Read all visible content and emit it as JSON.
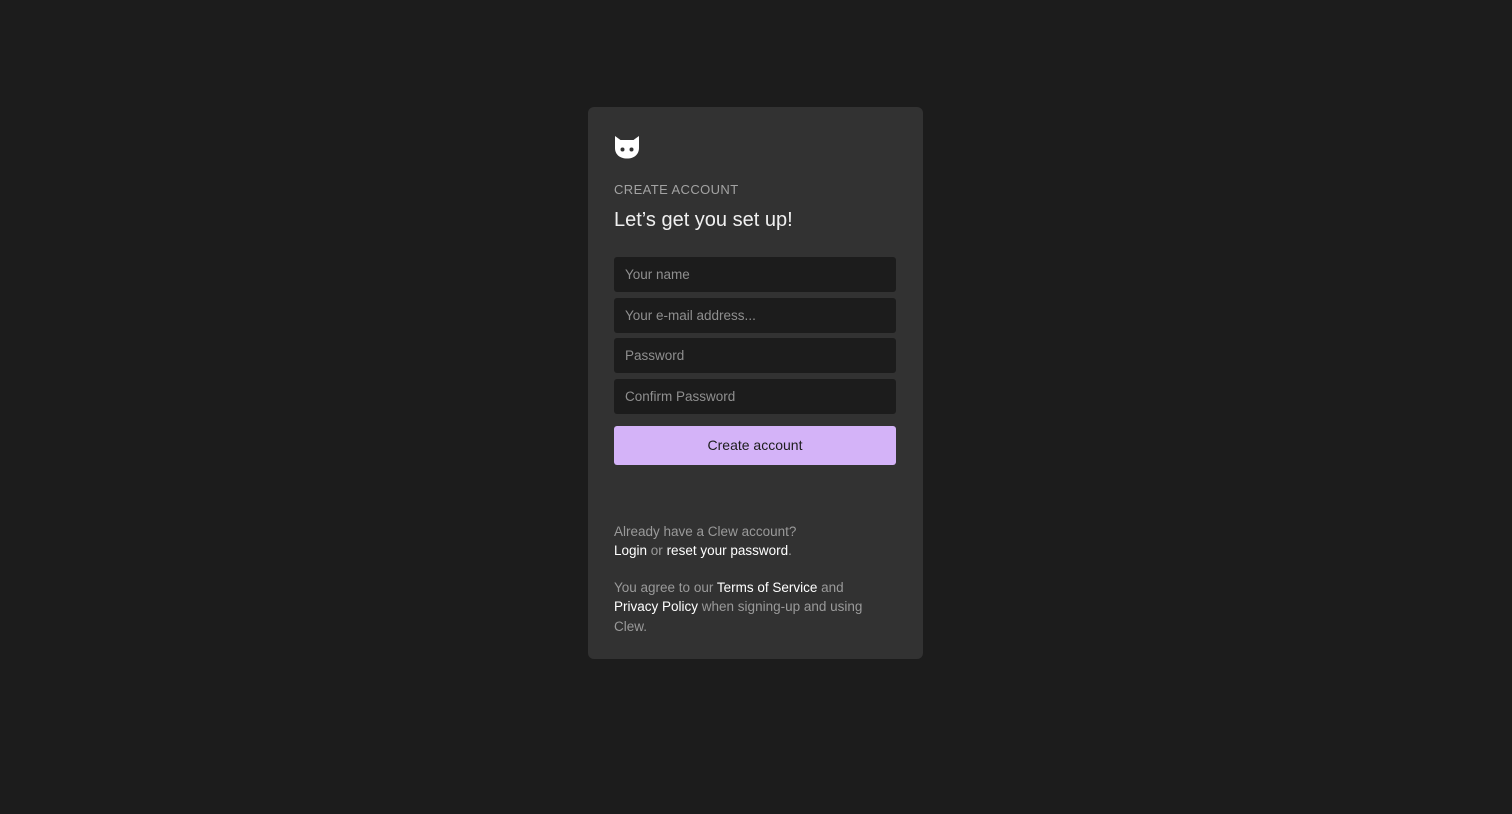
{
  "logo": {
    "icon": "cat-face-icon",
    "color": "#ffffff"
  },
  "header": {
    "eyebrow": "CREATE ACCOUNT",
    "title": "Let’s get you set up!"
  },
  "form": {
    "name_placeholder": "Your name",
    "email_placeholder": "Your e-mail address...",
    "password_placeholder": "Password",
    "confirm_placeholder": "Confirm Password",
    "submit_label": "Create account",
    "submit_color": "#d4b3f8"
  },
  "footer": {
    "existing_prompt": "Already have a Clew account?",
    "login_link": "Login",
    "or_text": " or ",
    "reset_link": "reset your password",
    "period": ".",
    "agree_prefix": "You agree to our ",
    "terms_link": "Terms of Service",
    "and_text": " and",
    "privacy_link": "Privacy Policy",
    "agree_suffix": " when signing-up and using Clew."
  },
  "colors": {
    "page_background": "#1c1c1c",
    "card_background": "#323232",
    "input_background": "#1c1c1c"
  }
}
